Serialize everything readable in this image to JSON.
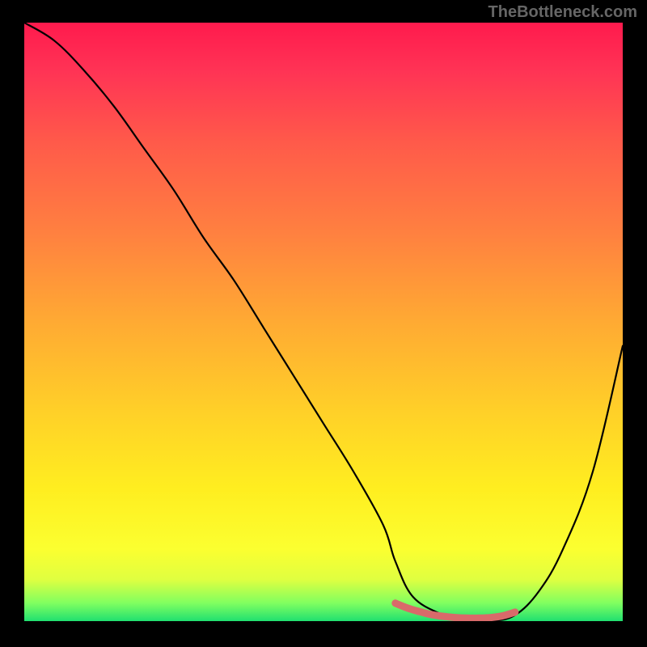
{
  "watermark": "TheBottleneck.com",
  "chart_data": {
    "type": "line",
    "title": "",
    "xlabel": "",
    "ylabel": "",
    "xlim": [
      0,
      100
    ],
    "ylim": [
      0,
      100
    ],
    "series": [
      {
        "name": "bottleneck-curve",
        "x": [
          0,
          5,
          10,
          15,
          20,
          25,
          30,
          35,
          40,
          45,
          50,
          55,
          60,
          62,
          65,
          70,
          73,
          75,
          78,
          82,
          86,
          90,
          95,
          100
        ],
        "values": [
          100,
          97,
          92,
          86,
          79,
          72,
          64,
          57,
          49,
          41,
          33,
          25,
          16,
          10,
          4,
          1,
          0,
          0,
          0,
          1,
          5,
          12,
          25,
          46
        ]
      },
      {
        "name": "optimal-highlight",
        "x": [
          62,
          64,
          66,
          68,
          70,
          72,
          74,
          76,
          78,
          80,
          82
        ],
        "values": [
          3,
          2.2,
          1.6,
          1.1,
          0.8,
          0.6,
          0.5,
          0.5,
          0.6,
          0.9,
          1.5
        ]
      }
    ],
    "gradient_stops": [
      {
        "pos": 0,
        "color": "#ff1a4d"
      },
      {
        "pos": 20,
        "color": "#ff5a4a"
      },
      {
        "pos": 50,
        "color": "#ffaa33"
      },
      {
        "pos": 78,
        "color": "#ffee20"
      },
      {
        "pos": 97,
        "color": "#80ff60"
      },
      {
        "pos": 100,
        "color": "#20e070"
      }
    ]
  }
}
